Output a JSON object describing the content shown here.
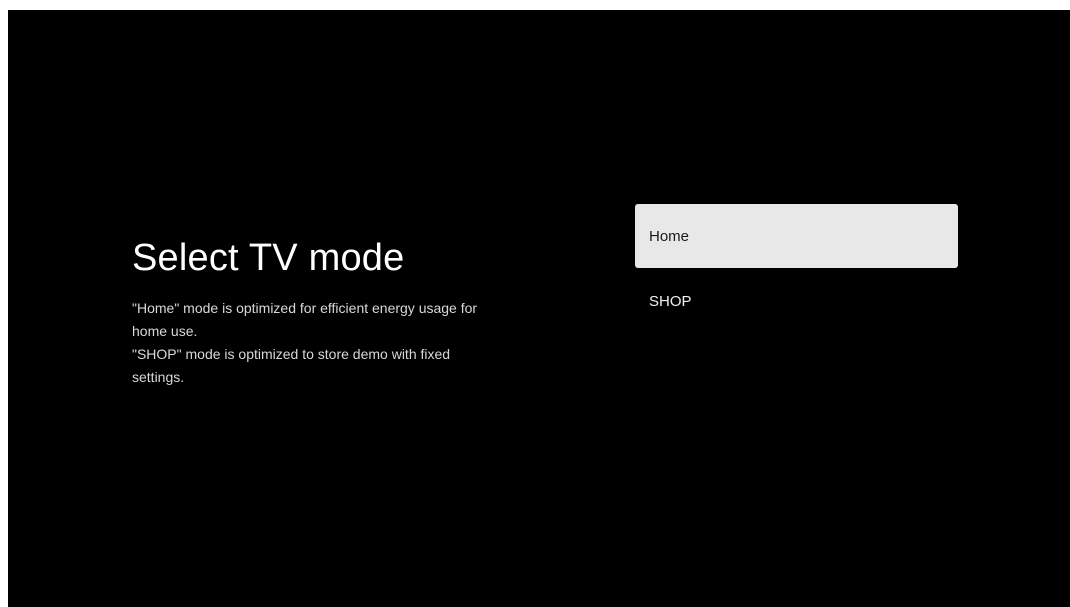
{
  "screen": {
    "title": "Select TV mode",
    "description": [
      "\"Home\" mode is optimized for efficient energy usage for",
      "home use.",
      "\"SHOP\" mode is optimized to store demo with fixed",
      "settings."
    ],
    "options": [
      {
        "label": "Home",
        "selected": true
      },
      {
        "label": "SHOP",
        "selected": false
      }
    ]
  },
  "colors": {
    "background": "#000000",
    "selected_option_bg": "#e8e8e8",
    "selected_option_text": "#1a1a1a",
    "text": "#ffffff"
  }
}
